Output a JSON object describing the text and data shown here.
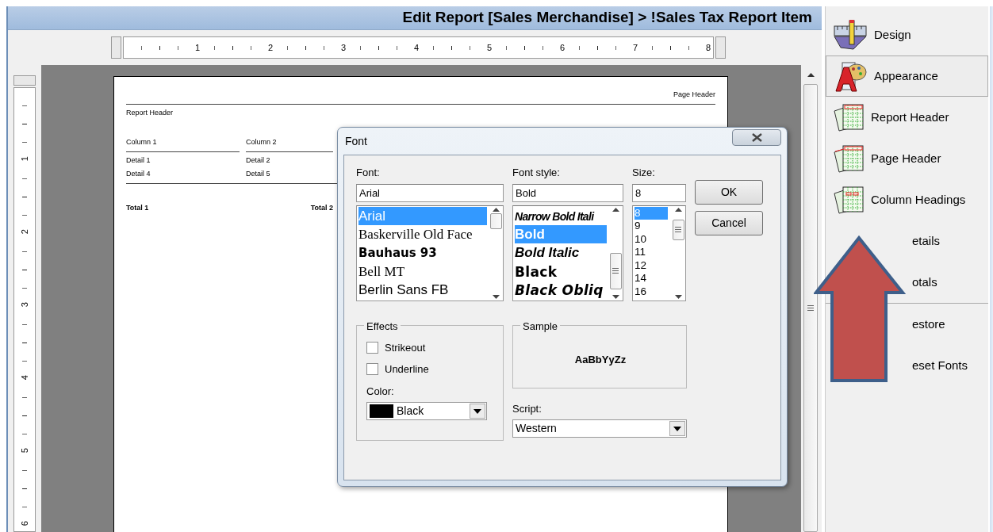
{
  "window": {
    "title": "Edit Report [Sales Merchandise] > !Sales Tax Report Item"
  },
  "horizontal_ruler": {
    "labels": [
      "1",
      "2",
      "3",
      "4",
      "5",
      "6",
      "7",
      "8"
    ]
  },
  "vertical_ruler": {
    "labels": [
      "1",
      "2",
      "3",
      "4",
      "5",
      "6"
    ]
  },
  "report_page": {
    "page_header": "Page Header",
    "report_header": "Report Header",
    "column_headings": [
      "Column 1",
      "Column 2"
    ],
    "detail_rows": [
      [
        "Detail 1",
        "Detail 2"
      ],
      [
        "Detail 4",
        "Detail 5"
      ]
    ],
    "totals": [
      "Total 1",
      "Total 2"
    ]
  },
  "font_dialog": {
    "title": "Font",
    "font": {
      "label": "Font:",
      "value": "Arial",
      "items": [
        {
          "label": "Arial",
          "kind": "sans",
          "selected": true
        },
        {
          "label": "Baskerville Old Face",
          "kind": "serif",
          "selected": false
        },
        {
          "label": "Bauhaus 93",
          "kind": "display",
          "selected": false
        },
        {
          "label": "Bell MT",
          "kind": "serif",
          "selected": false
        },
        {
          "label": "Berlin Sans FB",
          "kind": "sans",
          "selected": false
        }
      ]
    },
    "font_style": {
      "label": "Font style:",
      "value": "Bold",
      "items": [
        {
          "label": "Narrow Bold Itali",
          "kind": "narrow-bold-italic",
          "selected": false
        },
        {
          "label": "Bold",
          "kind": "bold",
          "selected": true
        },
        {
          "label": "Bold Italic",
          "kind": "bold-italic",
          "selected": false
        },
        {
          "label": "Black",
          "kind": "black",
          "selected": false
        },
        {
          "label": "Black Obliq",
          "kind": "black-oblique",
          "selected": false
        }
      ]
    },
    "size": {
      "label": "Size:",
      "value": "8",
      "items": [
        {
          "label": "8",
          "selected": true
        },
        {
          "label": "9",
          "selected": false
        },
        {
          "label": "10",
          "selected": false
        },
        {
          "label": "11",
          "selected": false
        },
        {
          "label": "12",
          "selected": false
        },
        {
          "label": "14",
          "selected": false
        },
        {
          "label": "16",
          "selected": false
        }
      ]
    },
    "buttons": [
      "OK",
      "Cancel"
    ],
    "effects": {
      "title": "Effects",
      "options": [
        {
          "label": "Strikeout",
          "checked": false
        },
        {
          "label": "Underline",
          "checked": false
        }
      ],
      "color_label": "Color:",
      "color": {
        "label": "Black",
        "color": "#000000"
      }
    },
    "sample": {
      "title": "Sample",
      "text": "AaBbYyZz"
    },
    "script": {
      "label": "Script:",
      "value": "Western"
    }
  },
  "sidebar": {
    "views": [
      {
        "label": "Design",
        "kind": "design",
        "selected": false
      },
      {
        "label": "Appearance",
        "kind": "appearance",
        "selected": true
      }
    ],
    "sections": [
      {
        "label": "Report Header",
        "kind": "report-header"
      },
      {
        "label": "Page Header",
        "kind": "page-header"
      },
      {
        "label": "Column Headings",
        "kind": "column-headings"
      },
      {
        "label": "etails"
      },
      {
        "label": "otals"
      }
    ],
    "actions": [
      {
        "label": "estore"
      },
      {
        "label": "eset Fonts"
      }
    ]
  }
}
